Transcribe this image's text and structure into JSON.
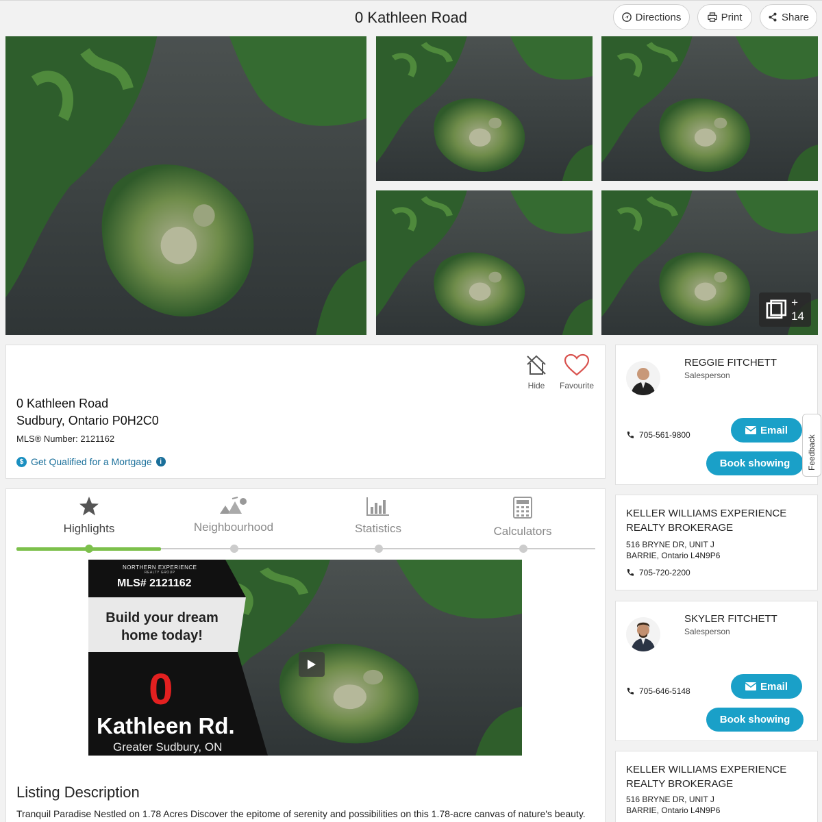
{
  "header": {
    "title": "0 Kathleen Road",
    "directions_label": "Directions",
    "print_label": "Print",
    "share_label": "Share"
  },
  "gallery": {
    "more_count": "+ 14"
  },
  "property": {
    "address_line1": "0 Kathleen Road",
    "address_line2": "Sudbury, Ontario P0H2C0",
    "mls_label": "MLS® Number:",
    "mls_value": "2121162",
    "mortgage_link": "Get Qualified for a Mortgage",
    "hide_label": "Hide",
    "favourite_label": "Favourite"
  },
  "tabs": [
    {
      "label": "Highlights",
      "icon": "star-icon",
      "active": true
    },
    {
      "label": "Neighbourhood",
      "icon": "neighbourhood-icon",
      "active": false
    },
    {
      "label": "Statistics",
      "icon": "bar-chart-icon",
      "active": false
    },
    {
      "label": "Calculators",
      "icon": "calculator-icon",
      "active": false
    }
  ],
  "video": {
    "brand": "NORTHERN EXPERIENCE",
    "brand_sub": "REALTY GROUP",
    "mls": "MLS# 2121162",
    "headline": "Build your dream home today!",
    "number": "0",
    "street": "Kathleen Rd.",
    "city": "Greater Sudbury, ON"
  },
  "description": {
    "title": "Listing Description",
    "text": "Tranquil Paradise Nestled on 1.78 Acres Discover the epitome of serenity and possibilities on this 1.78-acre canvas of nature's beauty."
  },
  "agents": [
    {
      "name": "REGGIE FITCHETT",
      "role": "Salesperson",
      "phone": "705-561-9800",
      "email_label": "Email",
      "book_label": "Book showing"
    },
    {
      "name": "SKYLER FITCHETT",
      "role": "Salesperson",
      "phone": "705-646-5148",
      "email_label": "Email",
      "book_label": "Book showing"
    }
  ],
  "brokerages": [
    {
      "name": "KELLER WILLIAMS EXPERIENCE REALTY BROKERAGE",
      "address1": "516 BRYNE DR, UNIT J",
      "address2": "BARRIE, Ontario L4N9P6",
      "phone": "705-720-2200"
    },
    {
      "name": "KELLER WILLIAMS EXPERIENCE REALTY BROKERAGE",
      "address1": "516 BRYNE DR, UNIT J",
      "address2": "BARRIE, Ontario L4N9P6"
    }
  ],
  "feedback_label": "Feedback",
  "colors": {
    "accent": "#1aa0c8",
    "tab_active": "#7cc04b",
    "favourite": "#d9534f",
    "video_zero": "#e32020"
  }
}
